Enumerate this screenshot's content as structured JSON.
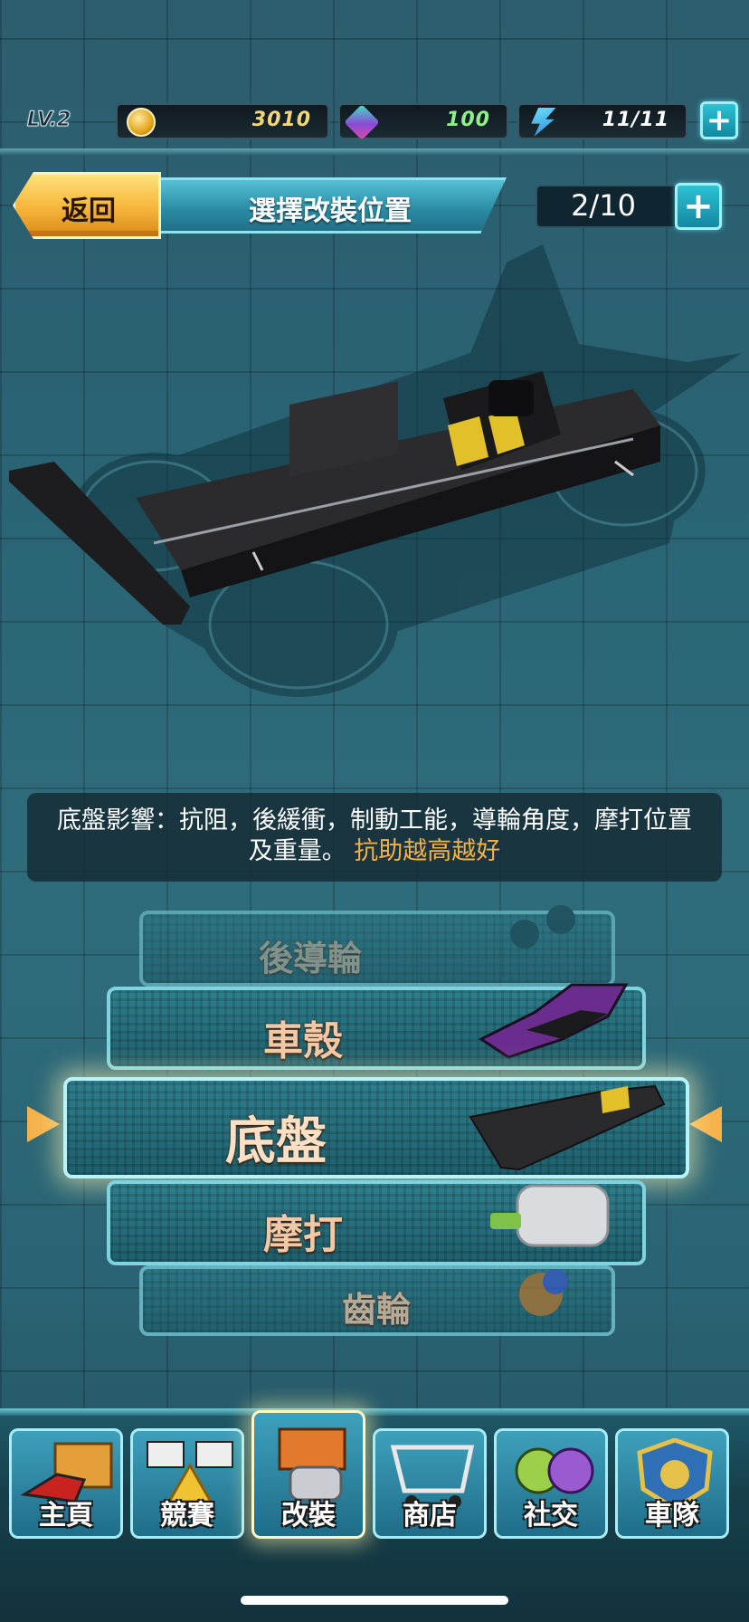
{
  "player": {
    "level": "LV.2"
  },
  "resources": {
    "coins": "3010",
    "gems": "100",
    "energy": "11/11"
  },
  "header": {
    "back_label": "返回",
    "title": "選擇改裝位置",
    "slots": "2/10"
  },
  "description": {
    "text": "底盤影響：抗阻，後緩衝，制動工能，導輪角度，摩打位置及重量。",
    "highlight": "抗助越高越好"
  },
  "parts": [
    {
      "label": "後導輪",
      "icon": "rear-roller-icon"
    },
    {
      "label": "車殼",
      "icon": "car-body-icon"
    },
    {
      "label": "底盤",
      "icon": "chassis-icon",
      "selected": true
    },
    {
      "label": "摩打",
      "icon": "motor-icon"
    },
    {
      "label": "齒輪",
      "icon": "gear-icon"
    }
  ],
  "nav": [
    {
      "label": "主頁",
      "icon": "home-car-icon"
    },
    {
      "label": "競賽",
      "icon": "race-flags-icon"
    },
    {
      "label": "改裝",
      "icon": "workshop-icon",
      "active": true
    },
    {
      "label": "商店",
      "icon": "shop-cart-icon"
    },
    {
      "label": "社交",
      "icon": "friends-icon"
    },
    {
      "label": "車隊",
      "icon": "team-badge-icon"
    }
  ],
  "colors": {
    "accent_gold": "#f6b24a",
    "accent_cyan": "#7fd3e0",
    "coin_text": "#f2d77a",
    "gem_text": "#8ef08a",
    "energy_text": "#ffffff"
  }
}
